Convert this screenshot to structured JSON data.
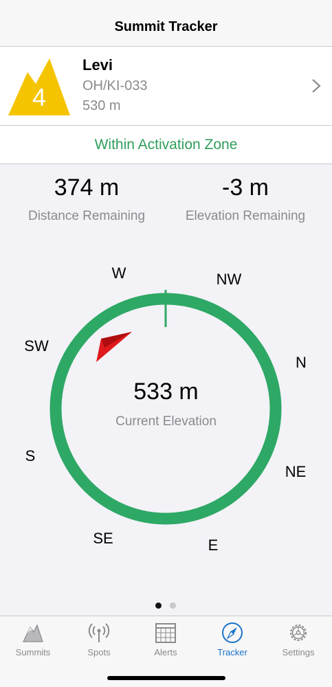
{
  "navbar": {
    "title": "Summit Tracker"
  },
  "summit": {
    "badge_number": "4",
    "badge_color": "#f5c400",
    "name": "Levi",
    "reference": "OH/KI-033",
    "altitude": "530 m",
    "chevron_icon": "chevron-right-icon"
  },
  "zone": {
    "status": "Within Activation Zone",
    "color": "#2e9d5b"
  },
  "stats": {
    "distance": {
      "value": "374 m",
      "label": "Distance Remaining"
    },
    "elevation": {
      "value": "-3 m",
      "label": "Elevation Remaining"
    }
  },
  "compass": {
    "directions": [
      "W",
      "NW",
      "N",
      "NE",
      "E",
      "SE",
      "S",
      "SW"
    ],
    "ring_color": "#2ea865",
    "pointer_color": "#e0191c",
    "current_elevation": "533 m",
    "current_elevation_label": "Current Elevation"
  },
  "pager": {
    "pages": 2,
    "active": 1
  },
  "tabs": [
    {
      "label": "Summits",
      "icon": "mountain-icon",
      "active": false
    },
    {
      "label": "Spots",
      "icon": "antenna-icon",
      "active": false
    },
    {
      "label": "Alerts",
      "icon": "calendar-icon",
      "active": false
    },
    {
      "label": "Tracker",
      "icon": "compass-icon",
      "active": true
    },
    {
      "label": "Settings",
      "icon": "gear-icon",
      "active": false
    }
  ]
}
